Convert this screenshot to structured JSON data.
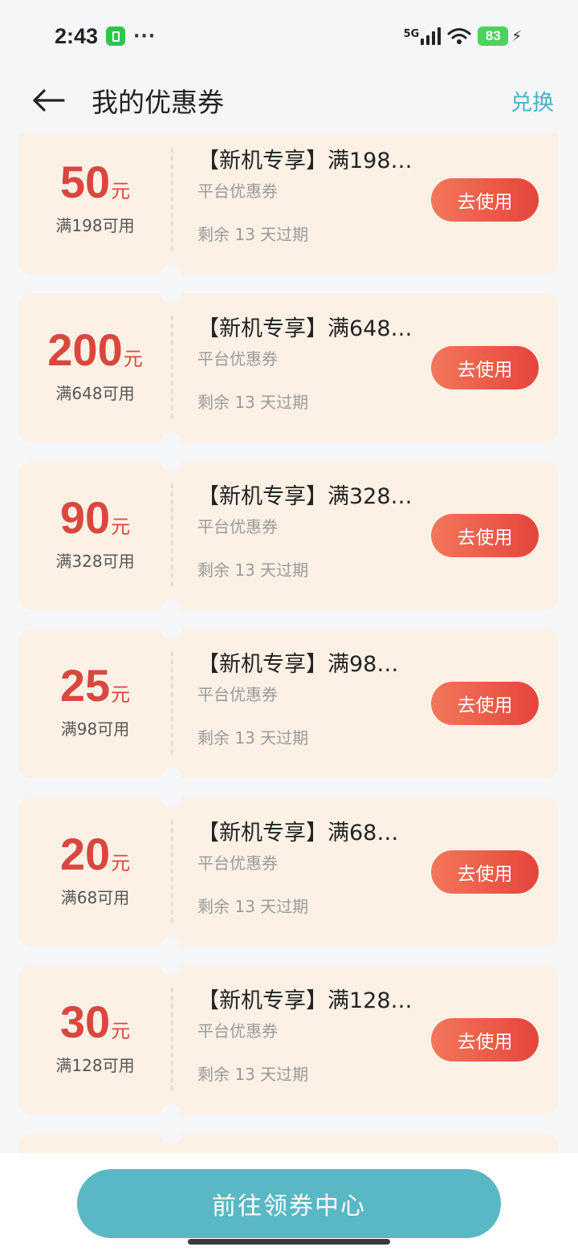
{
  "status_bar": {
    "time": "2:43",
    "more": "···",
    "network": "5G",
    "battery": "83"
  },
  "header": {
    "title": "我的优惠券",
    "action": "兑换"
  },
  "coupons": [
    {
      "amount": "50",
      "unit": "元",
      "threshold": "满198可用",
      "title": "【新机专享】满198…",
      "type": "平台优惠券",
      "expire": "剩余 13 天过期",
      "button": "去使用"
    },
    {
      "amount": "200",
      "unit": "元",
      "threshold": "满648可用",
      "title": "【新机专享】满648…",
      "type": "平台优惠券",
      "expire": "剩余 13 天过期",
      "button": "去使用"
    },
    {
      "amount": "90",
      "unit": "元",
      "threshold": "满328可用",
      "title": "【新机专享】满328…",
      "type": "平台优惠券",
      "expire": "剩余 13 天过期",
      "button": "去使用"
    },
    {
      "amount": "25",
      "unit": "元",
      "threshold": "满98可用",
      "title": "【新机专享】满98…",
      "type": "平台优惠券",
      "expire": "剩余 13 天过期",
      "button": "去使用"
    },
    {
      "amount": "20",
      "unit": "元",
      "threshold": "满68可用",
      "title": "【新机专享】满68…",
      "type": "平台优惠券",
      "expire": "剩余 13 天过期",
      "button": "去使用"
    },
    {
      "amount": "30",
      "unit": "元",
      "threshold": "满128可用",
      "title": "【新机专享】满128…",
      "type": "平台优惠券",
      "expire": "剩余 13 天过期",
      "button": "去使用"
    }
  ],
  "bottom": {
    "button": "前往领券中心"
  },
  "colors": {
    "accent": "#4eb0c6",
    "amount": "#d9473f",
    "coupon_bg": "#fdf1e6",
    "cta": "#5ab8c4"
  }
}
